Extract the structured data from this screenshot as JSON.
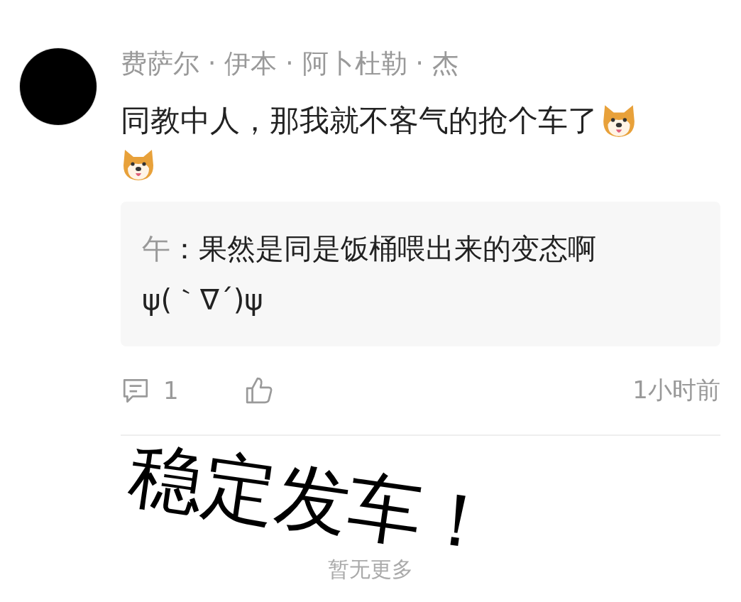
{
  "comment": {
    "author": "费萨尔 · 伊本 · 阿卜杜勒 · 杰",
    "text": "同教中人，那我就不客气的抢个车了",
    "reply": {
      "author": "午",
      "text": "：果然是同是饭桶喂出来的变态啊",
      "kaomoji": "ψ(｀∇´)ψ"
    },
    "reply_count": "1",
    "time": "1小时前"
  },
  "end_note": "暂无更多",
  "overlay_caption": "稳定发车！"
}
